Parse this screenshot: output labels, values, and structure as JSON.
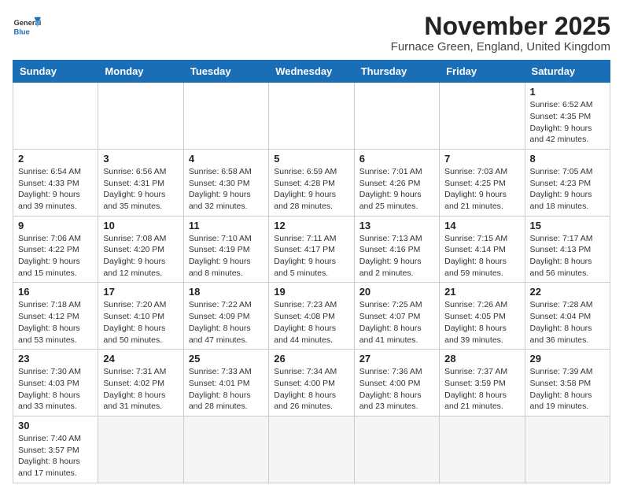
{
  "header": {
    "logo_text_general": "General",
    "logo_text_blue": "Blue",
    "month_year": "November 2025",
    "location": "Furnace Green, England, United Kingdom"
  },
  "weekdays": [
    "Sunday",
    "Monday",
    "Tuesday",
    "Wednesday",
    "Thursday",
    "Friday",
    "Saturday"
  ],
  "weeks": [
    [
      {
        "day": "",
        "info": ""
      },
      {
        "day": "",
        "info": ""
      },
      {
        "day": "",
        "info": ""
      },
      {
        "day": "",
        "info": ""
      },
      {
        "day": "",
        "info": ""
      },
      {
        "day": "",
        "info": ""
      },
      {
        "day": "1",
        "info": "Sunrise: 6:52 AM\nSunset: 4:35 PM\nDaylight: 9 hours\nand 42 minutes."
      }
    ],
    [
      {
        "day": "2",
        "info": "Sunrise: 6:54 AM\nSunset: 4:33 PM\nDaylight: 9 hours\nand 39 minutes."
      },
      {
        "day": "3",
        "info": "Sunrise: 6:56 AM\nSunset: 4:31 PM\nDaylight: 9 hours\nand 35 minutes."
      },
      {
        "day": "4",
        "info": "Sunrise: 6:58 AM\nSunset: 4:30 PM\nDaylight: 9 hours\nand 32 minutes."
      },
      {
        "day": "5",
        "info": "Sunrise: 6:59 AM\nSunset: 4:28 PM\nDaylight: 9 hours\nand 28 minutes."
      },
      {
        "day": "6",
        "info": "Sunrise: 7:01 AM\nSunset: 4:26 PM\nDaylight: 9 hours\nand 25 minutes."
      },
      {
        "day": "7",
        "info": "Sunrise: 7:03 AM\nSunset: 4:25 PM\nDaylight: 9 hours\nand 21 minutes."
      },
      {
        "day": "8",
        "info": "Sunrise: 7:05 AM\nSunset: 4:23 PM\nDaylight: 9 hours\nand 18 minutes."
      }
    ],
    [
      {
        "day": "9",
        "info": "Sunrise: 7:06 AM\nSunset: 4:22 PM\nDaylight: 9 hours\nand 15 minutes."
      },
      {
        "day": "10",
        "info": "Sunrise: 7:08 AM\nSunset: 4:20 PM\nDaylight: 9 hours\nand 12 minutes."
      },
      {
        "day": "11",
        "info": "Sunrise: 7:10 AM\nSunset: 4:19 PM\nDaylight: 9 hours\nand 8 minutes."
      },
      {
        "day": "12",
        "info": "Sunrise: 7:11 AM\nSunset: 4:17 PM\nDaylight: 9 hours\nand 5 minutes."
      },
      {
        "day": "13",
        "info": "Sunrise: 7:13 AM\nSunset: 4:16 PM\nDaylight: 9 hours\nand 2 minutes."
      },
      {
        "day": "14",
        "info": "Sunrise: 7:15 AM\nSunset: 4:14 PM\nDaylight: 8 hours\nand 59 minutes."
      },
      {
        "day": "15",
        "info": "Sunrise: 7:17 AM\nSunset: 4:13 PM\nDaylight: 8 hours\nand 56 minutes."
      }
    ],
    [
      {
        "day": "16",
        "info": "Sunrise: 7:18 AM\nSunset: 4:12 PM\nDaylight: 8 hours\nand 53 minutes."
      },
      {
        "day": "17",
        "info": "Sunrise: 7:20 AM\nSunset: 4:10 PM\nDaylight: 8 hours\nand 50 minutes."
      },
      {
        "day": "18",
        "info": "Sunrise: 7:22 AM\nSunset: 4:09 PM\nDaylight: 8 hours\nand 47 minutes."
      },
      {
        "day": "19",
        "info": "Sunrise: 7:23 AM\nSunset: 4:08 PM\nDaylight: 8 hours\nand 44 minutes."
      },
      {
        "day": "20",
        "info": "Sunrise: 7:25 AM\nSunset: 4:07 PM\nDaylight: 8 hours\nand 41 minutes."
      },
      {
        "day": "21",
        "info": "Sunrise: 7:26 AM\nSunset: 4:05 PM\nDaylight: 8 hours\nand 39 minutes."
      },
      {
        "day": "22",
        "info": "Sunrise: 7:28 AM\nSunset: 4:04 PM\nDaylight: 8 hours\nand 36 minutes."
      }
    ],
    [
      {
        "day": "23",
        "info": "Sunrise: 7:30 AM\nSunset: 4:03 PM\nDaylight: 8 hours\nand 33 minutes."
      },
      {
        "day": "24",
        "info": "Sunrise: 7:31 AM\nSunset: 4:02 PM\nDaylight: 8 hours\nand 31 minutes."
      },
      {
        "day": "25",
        "info": "Sunrise: 7:33 AM\nSunset: 4:01 PM\nDaylight: 8 hours\nand 28 minutes."
      },
      {
        "day": "26",
        "info": "Sunrise: 7:34 AM\nSunset: 4:00 PM\nDaylight: 8 hours\nand 26 minutes."
      },
      {
        "day": "27",
        "info": "Sunrise: 7:36 AM\nSunset: 4:00 PM\nDaylight: 8 hours\nand 23 minutes."
      },
      {
        "day": "28",
        "info": "Sunrise: 7:37 AM\nSunset: 3:59 PM\nDaylight: 8 hours\nand 21 minutes."
      },
      {
        "day": "29",
        "info": "Sunrise: 7:39 AM\nSunset: 3:58 PM\nDaylight: 8 hours\nand 19 minutes."
      }
    ],
    [
      {
        "day": "30",
        "info": "Sunrise: 7:40 AM\nSunset: 3:57 PM\nDaylight: 8 hours\nand 17 minutes."
      },
      {
        "day": "",
        "info": ""
      },
      {
        "day": "",
        "info": ""
      },
      {
        "day": "",
        "info": ""
      },
      {
        "day": "",
        "info": ""
      },
      {
        "day": "",
        "info": ""
      },
      {
        "day": "",
        "info": ""
      }
    ]
  ]
}
